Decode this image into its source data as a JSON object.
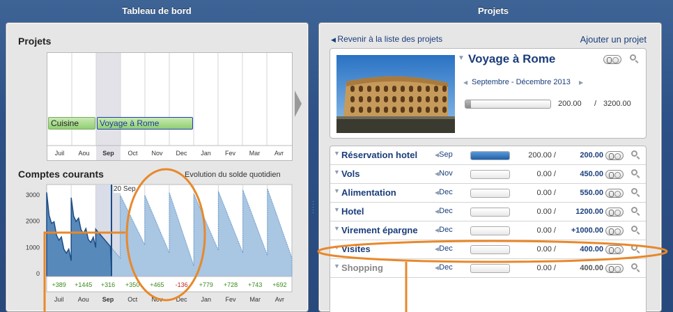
{
  "left_panel": {
    "title": "Tableau de bord",
    "projects": {
      "heading": "Projets",
      "months": [
        "Juil",
        "Aou",
        "Sep",
        "Oct",
        "Nov",
        "Dec",
        "Jan",
        "Fev",
        "Mar",
        "Avr"
      ],
      "selected_month": "Sep",
      "bars": [
        {
          "label": "Cuisine",
          "start_month": 0,
          "end_month": 2
        },
        {
          "label": "Voyage à Rome",
          "start_month": 2,
          "end_month": 6
        }
      ]
    },
    "accounts": {
      "heading": "Comptes courants",
      "subtitle": "Evolution du solde quotidien",
      "marker": "20 Sep",
      "y_ticks": [
        "3000",
        "2000",
        "1000",
        "0"
      ],
      "months": [
        "Juil",
        "Aou",
        "Sep",
        "Oct",
        "Nov",
        "Dec",
        "Jan",
        "Fev",
        "Mar",
        "Avr"
      ],
      "monthly_deltas": [
        "+389",
        "+1445",
        "+316",
        "+350",
        "+465",
        "-136",
        "+779",
        "+728",
        "+743",
        "+692"
      ]
    }
  },
  "right_panel": {
    "title": "Projets",
    "back_link": "Revenir à la liste des projets",
    "add_link": "Ajouter un projet",
    "project": {
      "name": "Voyage à Rome",
      "period": "Septembre - Décembre 2013",
      "spent": "200.00",
      "separator": "/",
      "budget": "3200.00",
      "progress": 0.0625
    },
    "items": [
      {
        "name": "Réservation hotel",
        "month": "Sep",
        "progress": 1.0,
        "spent": "200.00 /",
        "budget": "200.00"
      },
      {
        "name": "Vols",
        "month": "Nov",
        "progress": 0,
        "spent": "0.00 /",
        "budget": "450.00"
      },
      {
        "name": "Alimentation",
        "month": "Dec",
        "progress": 0,
        "spent": "0.00 /",
        "budget": "550.00"
      },
      {
        "name": "Hotel",
        "month": "Dec",
        "progress": 0,
        "spent": "0.00 /",
        "budget": "1200.00"
      },
      {
        "name": "Virement épargne",
        "month": "Dec",
        "progress": 0,
        "spent": "0.00 /",
        "budget": "+1000.00"
      },
      {
        "name": "Visites",
        "month": "Dec",
        "progress": 0,
        "spent": "0.00 /",
        "budget": "400.00"
      },
      {
        "name": "Shopping",
        "month": "Dec",
        "progress": 0,
        "spent": "0.00 /",
        "budget": "400.00"
      }
    ]
  },
  "colors": {
    "accent": "#e8882a",
    "blue": "#1a3d7a",
    "chart_fill": "#a9c6e3"
  }
}
